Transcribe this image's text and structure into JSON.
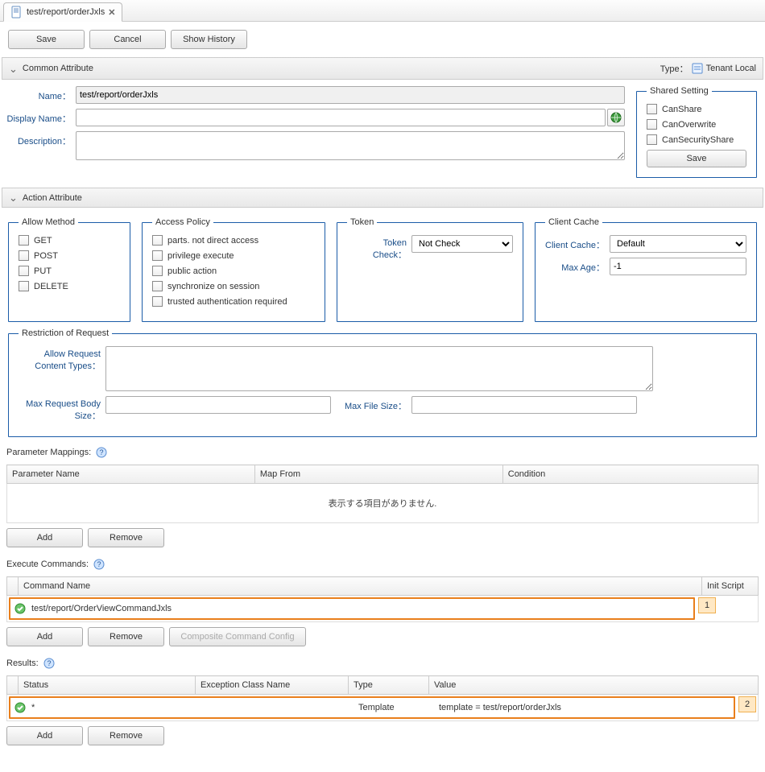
{
  "tab": {
    "title": "test/report/orderJxls"
  },
  "toolbar": {
    "save": "Save",
    "cancel": "Cancel",
    "history": "Show History"
  },
  "common": {
    "header": "Common Attribute",
    "type_label": "Type：",
    "type_value": "Tenant Local",
    "name_label": "Name：",
    "name_value": "test/report/orderJxls",
    "display_label": "Display Name：",
    "display_value": "",
    "desc_label": "Description：",
    "desc_value": "",
    "shared": {
      "legend": "Shared Setting",
      "canShare": "CanShare",
      "canOverwrite": "CanOverwrite",
      "canSecurityShare": "CanSecurityShare",
      "save": "Save"
    }
  },
  "action": {
    "header": "Action Attribute",
    "allow_method": {
      "legend": "Allow Method",
      "get": "GET",
      "post": "POST",
      "put": "PUT",
      "delete": "DELETE"
    },
    "access_policy": {
      "legend": "Access Policy",
      "parts": "parts. not direct access",
      "privilege": "privilege execute",
      "public": "public action",
      "sync": "synchronize on session",
      "trusted": "trusted authentication required"
    },
    "token": {
      "legend": "Token",
      "check_label": "Token Check：",
      "check_value": "Not Check"
    },
    "cache": {
      "legend": "Client Cache",
      "cache_label": "Client Cache：",
      "cache_value": "Default",
      "maxage_label": "Max Age：",
      "maxage_value": "-1"
    },
    "restriction": {
      "legend": "Restriction of Request",
      "allow_ct_label": "Allow Request Content Types：",
      "max_body_label": "Max Request Body Size：",
      "max_file_label": "Max File Size："
    }
  },
  "param": {
    "label": "Parameter Mappings:",
    "cols": {
      "name": "Parameter Name",
      "from": "Map From",
      "cond": "Condition"
    },
    "empty": "表示する項目がありません.",
    "add": "Add",
    "remove": "Remove"
  },
  "exec": {
    "label": "Execute Commands:",
    "cols": {
      "name": "Command Name",
      "init": "Init Script"
    },
    "row0": "test/report/OrderViewCommandJxls",
    "badge0": "1",
    "add": "Add",
    "remove": "Remove",
    "composite": "Composite Command Config"
  },
  "results": {
    "label": "Results:",
    "cols": {
      "status": "Status",
      "ex": "Exception Class Name",
      "type": "Type",
      "value": "Value"
    },
    "row0": {
      "status": "*",
      "type": "Template",
      "value": "template = test/report/orderJxls"
    },
    "badge0": "2",
    "add": "Add",
    "remove": "Remove"
  }
}
